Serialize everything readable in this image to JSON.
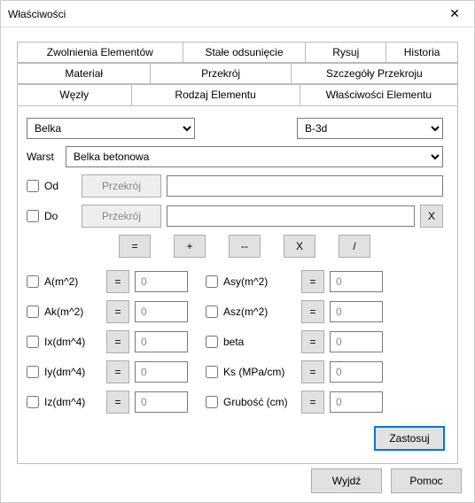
{
  "window": {
    "title": "Właściwości"
  },
  "tabs": {
    "row1": [
      "Zwolnienia Elementów",
      "Stałe odsunięcie",
      "Rysuj",
      "Historia"
    ],
    "row2": [
      "Materiał",
      "Przekrój",
      "Szczegóły Przekroju"
    ],
    "row3": [
      "Węzły",
      "Rodzaj Elementu",
      "Właściwości Elementu"
    ]
  },
  "selectors": {
    "type": "Belka",
    "code": "B-3d",
    "warst_label": "Warst",
    "warst_value": "Belka betonowa"
  },
  "section": {
    "from_label": "Od",
    "to_label": "Do",
    "btn_label": "Przekrój",
    "from_value": "",
    "to_value": "",
    "clear_label": "X"
  },
  "ops": {
    "eq": "=",
    "plus": "+",
    "minus": "--",
    "mul": "X",
    "div": "/"
  },
  "props": {
    "left": [
      {
        "label": "A(m^2)",
        "value": "0"
      },
      {
        "label": "Ak(m^2)",
        "value": "0"
      },
      {
        "label": "Ix(dm^4)",
        "value": "0"
      },
      {
        "label": "Iy(dm^4)",
        "value": "0"
      },
      {
        "label": "Iz(dm^4)",
        "value": "0"
      }
    ],
    "right": [
      {
        "label": "Asy(m^2)",
        "value": "0"
      },
      {
        "label": "Asz(m^2)",
        "value": "0"
      },
      {
        "label": "beta",
        "value": "0"
      },
      {
        "label": "Ks (MPa/cm)",
        "value": "0"
      },
      {
        "label": "Grubość (cm)",
        "value": "0"
      }
    ],
    "eq_btn": "="
  },
  "buttons": {
    "apply": "Zastosuj",
    "exit": "Wyjdź",
    "help": "Pomoc"
  }
}
